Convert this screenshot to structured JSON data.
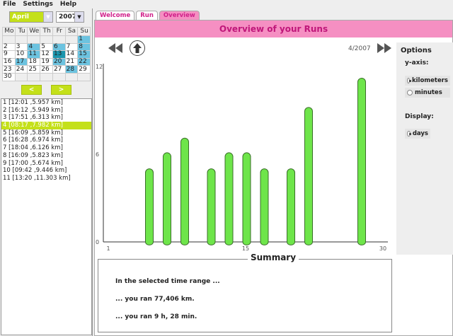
{
  "menu": [
    "File",
    "Settings",
    "Help"
  ],
  "month": "April",
  "year": "2007",
  "calendar": {
    "weekdays": [
      "Mo",
      "Tu",
      "We",
      "Th",
      "Fr",
      "Sa",
      "Su"
    ],
    "weeks": [
      [
        "",
        "",
        "",
        "",
        "",
        "",
        "1"
      ],
      [
        "2",
        "3",
        "4",
        "5",
        "6",
        "7",
        "8"
      ],
      [
        "9",
        "10",
        "11",
        "12",
        "13",
        "14",
        "15"
      ],
      [
        "16",
        "17",
        "18",
        "19",
        "20",
        "21",
        "22"
      ],
      [
        "23",
        "24",
        "25",
        "26",
        "27",
        "28",
        "29"
      ],
      [
        "30",
        "",
        "",
        "",
        "",
        "",
        ""
      ]
    ],
    "run_days": [
      "1",
      "4",
      "6",
      "8",
      "11",
      "13",
      "15",
      "17",
      "20",
      "22",
      "28"
    ],
    "selected_day": "13"
  },
  "prev_label": "<",
  "next_label": ">",
  "runs": [
    "1  [12:01 ,5.957 km]",
    "2  [16:12 ,5.949 km]",
    "3  [17:51 ,6.313 km]",
    "4  [08:17 ,7.982 km]",
    "5  [16:09 ,5.859 km]",
    "6  [16:28 ,6.974 km]",
    "7  [18:04 ,6.126 km]",
    "8  [16:09 ,5.823 km]",
    "9  [17:00 ,5.674 km]",
    "10  [09:42 ,9.446 km]",
    "11  [13:20 ,11.303 km]"
  ],
  "selected_run": 3,
  "tabs": [
    "Welcome",
    "Run",
    "Overview"
  ],
  "banner": "Overview of your Runs",
  "period": "4/2007",
  "options": {
    "title": "Options",
    "yaxis": "y-axis:",
    "km": "kilometers",
    "min": "minutes",
    "display": "Display:",
    "days": "days"
  },
  "chart_data": {
    "type": "bar",
    "x": [
      4,
      6,
      8,
      11,
      13,
      15,
      17,
      20,
      22,
      28
    ],
    "values": [
      5.0,
      6.1,
      7.1,
      5.0,
      6.1,
      6.1,
      5.0,
      5.0,
      9.2,
      11.2
    ],
    "xlim": [
      1,
      30
    ],
    "ylim": [
      0,
      12
    ],
    "xticks": [
      "1",
      "15",
      "30"
    ],
    "yticks": [
      "0",
      "6",
      "12"
    ],
    "ylabel": "kilometers",
    "xlabel": "days"
  },
  "summary": {
    "title": "Summary",
    "line1": "In the selected time range ...",
    "line2": "... you ran  77,406 km.",
    "line3": "... you ran  9 h, 28 min."
  },
  "colors": {
    "accent": "#c4e01a",
    "pink": "#f58fc2",
    "bar": "#6ee54a",
    "run_day": "#6cc3e0"
  }
}
